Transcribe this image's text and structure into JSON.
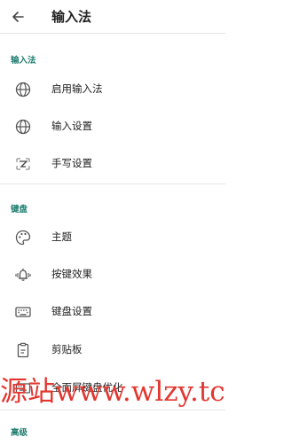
{
  "header": {
    "title": "输入法"
  },
  "sections": [
    {
      "title": "输入法",
      "items": [
        {
          "label": "启用输入法",
          "icon": "globe-icon"
        },
        {
          "label": "输入设置",
          "icon": "globe-icon"
        },
        {
          "label": "手写设置",
          "icon": "handwriting-icon"
        }
      ]
    },
    {
      "title": "键盘",
      "items": [
        {
          "label": "主题",
          "icon": "palette-icon"
        },
        {
          "label": "按键效果",
          "icon": "vibrate-bell-icon"
        },
        {
          "label": "键盘设置",
          "icon": "keyboard-icon"
        },
        {
          "label": "剪贴板",
          "icon": "clipboard-icon"
        },
        {
          "label": "全面屏键盘优化",
          "icon": "fullscreen-keyboard-icon"
        }
      ]
    },
    {
      "title": "高级"
    }
  ],
  "watermark": {
    "text": "源站www.wlzy.tc"
  },
  "colors": {
    "accent": "#1e7d6f",
    "watermark": "#e2362f"
  }
}
